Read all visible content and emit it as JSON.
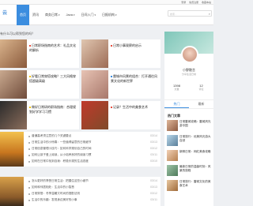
{
  "topbar": {
    "links": [
      "登录",
      "免费注册",
      "收藏本站"
    ]
  },
  "header": {
    "logo": "云",
    "search_placeholder": "搜索...",
    "nav": [
      {
        "label": "首页",
        "active": true
      },
      {
        "label": "资讯",
        "caret": false
      },
      {
        "label": "商务日常",
        "caret": true
      },
      {
        "label": "Java",
        "caret": true
      },
      {
        "label": "日间入门",
        "caret": true
      },
      {
        "label": "日报机构",
        "caret": true
      }
    ]
  },
  "breadcrumb": "有什么可以帮到您的吗？",
  "cards": [
    {
      "title": "日常职场指南的艺术：礼品文化的解析",
      "badge_color": "#e74c3c"
    },
    {
      "title": "日常小事观察的启示",
      "badge_color": "#e74c3c"
    },
    {
      "title": "好看日常穿搭攻略？三大风格穿搭超级高级",
      "badge_color": "#f1c40f"
    },
    {
      "title": "雷城市风景的组合：打开通往风景文化的新世界",
      "badge_color": "#3b8ddf"
    },
    {
      "title": "做好日常研的职场指南：合理规划好学学习习惯",
      "badge_color": "#f1c40f"
    },
    {
      "title": "记录？生活中的美食艺术",
      "badge_color": "#e74c3c"
    }
  ],
  "sidebar": {
    "name": "小野散言",
    "tagline": "分享生活日常",
    "stats": [
      {
        "label": "文章",
        "value": "1398"
      },
      {
        "label": "评论",
        "value": "12"
      }
    ],
    "tabs": [
      "热门",
      "最新"
    ],
    "section_title": "热门文章",
    "items": [
      {
        "title": "日常雷城攻略：雷城风光游中国"
      },
      {
        "title": "日常旅行：优美风光游大自然"
      },
      {
        "title": "新鲜日常：网红美食攻略"
      },
      {
        "title": "最新日常的温馨时刻：风景的旅程"
      },
      {
        "title": "日常旅行：雷城文化的美食艺术"
      }
    ]
  },
  "panel1": {
    "rows": [
      {
        "text": "普通高考须注意的几个关键要点",
        "date": "03/14"
      },
      {
        "text": "日常生活中的小惊喜：一些值得留意的日常细节",
        "date": "03/13"
      },
      {
        "text": "日常信息管理小技巧：如何科学规划自己的时间",
        "date": "03/12"
      },
      {
        "text": "如何让孩子爱上阅读，从小培养良好的阅读习惯",
        "date": "03/11"
      },
      {
        "text": "如何在日常中找到自我：积极乐观的生活态度",
        "date": "03/10"
      },
      {
        "text": "日常生活小贴士：如何快乐而简单地度过每一天",
        "date": "03/09"
      }
    ]
  },
  "panel2": {
    "rows": [
      {
        "text": "怎么更好的享受日常生活：把握住这些小细节",
        "date": "03/14"
      },
      {
        "text": "如何和邻居相处：生活中的小智慧",
        "date": "03/13"
      },
      {
        "text": "日常穿搭：冬季温暖又时尚的搭配法则",
        "date": "03/12"
      },
      {
        "text": "生活中的乐趣：发现身边美好的小事",
        "date": "03/11"
      }
    ]
  }
}
